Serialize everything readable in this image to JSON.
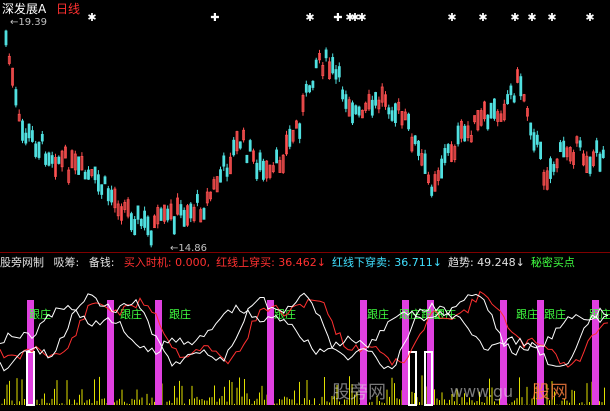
{
  "header": {
    "stock_name": "深发展A",
    "period": "日线",
    "high_price": "19.39",
    "low_price": "14.86"
  },
  "indicator_bar": {
    "name": "股旁网制",
    "items": [
      {
        "label": "吸筹:",
        "value": "",
        "color": "#e0e0e0"
      },
      {
        "label": "备钱:",
        "value": "",
        "color": "#e0e0e0"
      },
      {
        "label": "买入时机:",
        "value": "0.000,",
        "color": "#ff3030"
      },
      {
        "label": "红线上穿买:",
        "value": "36.462↓",
        "color": "#ff3030"
      },
      {
        "label": "红线下穿卖:",
        "value": "36.711↓",
        "color": "#40e0ff"
      },
      {
        "label": "趋势:",
        "value": "49.248↓",
        "color": "#e0e0e0"
      },
      {
        "label": "秘密买点",
        "value": "",
        "color": "#40ff40"
      }
    ]
  },
  "markers": {
    "star_glyph": "✱",
    "plus_glyph": "✚",
    "follow_label": "跟庄",
    "follow_label_overlap": "跟庄跟庄"
  },
  "watermarks": {
    "left": "股旁网",
    "mid": "www.gu",
    "right": "股网"
  },
  "colors": {
    "up_candle": "#ff5050",
    "down_candle": "#50e0e0",
    "magenta_bar": "#e040e0",
    "red_line": "#ff3030",
    "white_line": "#ffffff",
    "yellow_hist": "#e0e000",
    "follow_text": "#40ff40"
  }
}
